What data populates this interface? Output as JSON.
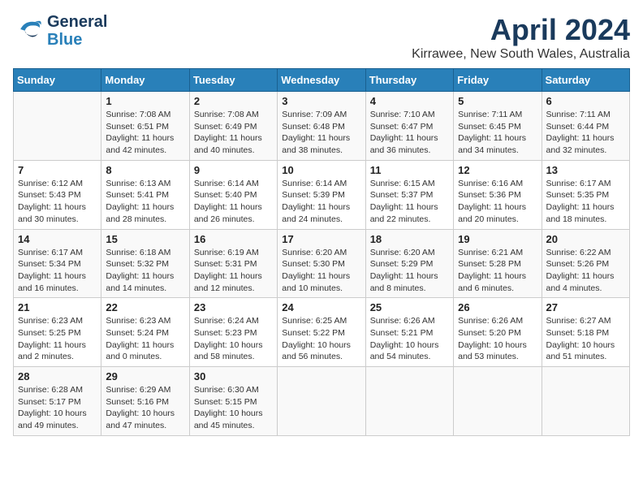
{
  "header": {
    "logo_line1": "General",
    "logo_line2": "Blue",
    "title": "April 2024",
    "subtitle": "Kirrawee, New South Wales, Australia"
  },
  "days_of_week": [
    "Sunday",
    "Monday",
    "Tuesday",
    "Wednesday",
    "Thursday",
    "Friday",
    "Saturday"
  ],
  "weeks": [
    [
      {
        "day": "",
        "sunrise": "",
        "sunset": "",
        "daylight": ""
      },
      {
        "day": "1",
        "sunrise": "Sunrise: 7:08 AM",
        "sunset": "Sunset: 6:51 PM",
        "daylight": "Daylight: 11 hours and 42 minutes."
      },
      {
        "day": "2",
        "sunrise": "Sunrise: 7:08 AM",
        "sunset": "Sunset: 6:49 PM",
        "daylight": "Daylight: 11 hours and 40 minutes."
      },
      {
        "day": "3",
        "sunrise": "Sunrise: 7:09 AM",
        "sunset": "Sunset: 6:48 PM",
        "daylight": "Daylight: 11 hours and 38 minutes."
      },
      {
        "day": "4",
        "sunrise": "Sunrise: 7:10 AM",
        "sunset": "Sunset: 6:47 PM",
        "daylight": "Daylight: 11 hours and 36 minutes."
      },
      {
        "day": "5",
        "sunrise": "Sunrise: 7:11 AM",
        "sunset": "Sunset: 6:45 PM",
        "daylight": "Daylight: 11 hours and 34 minutes."
      },
      {
        "day": "6",
        "sunrise": "Sunrise: 7:11 AM",
        "sunset": "Sunset: 6:44 PM",
        "daylight": "Daylight: 11 hours and 32 minutes."
      }
    ],
    [
      {
        "day": "7",
        "sunrise": "Sunrise: 6:12 AM",
        "sunset": "Sunset: 5:43 PM",
        "daylight": "Daylight: 11 hours and 30 minutes."
      },
      {
        "day": "8",
        "sunrise": "Sunrise: 6:13 AM",
        "sunset": "Sunset: 5:41 PM",
        "daylight": "Daylight: 11 hours and 28 minutes."
      },
      {
        "day": "9",
        "sunrise": "Sunrise: 6:14 AM",
        "sunset": "Sunset: 5:40 PM",
        "daylight": "Daylight: 11 hours and 26 minutes."
      },
      {
        "day": "10",
        "sunrise": "Sunrise: 6:14 AM",
        "sunset": "Sunset: 5:39 PM",
        "daylight": "Daylight: 11 hours and 24 minutes."
      },
      {
        "day": "11",
        "sunrise": "Sunrise: 6:15 AM",
        "sunset": "Sunset: 5:37 PM",
        "daylight": "Daylight: 11 hours and 22 minutes."
      },
      {
        "day": "12",
        "sunrise": "Sunrise: 6:16 AM",
        "sunset": "Sunset: 5:36 PM",
        "daylight": "Daylight: 11 hours and 20 minutes."
      },
      {
        "day": "13",
        "sunrise": "Sunrise: 6:17 AM",
        "sunset": "Sunset: 5:35 PM",
        "daylight": "Daylight: 11 hours and 18 minutes."
      }
    ],
    [
      {
        "day": "14",
        "sunrise": "Sunrise: 6:17 AM",
        "sunset": "Sunset: 5:34 PM",
        "daylight": "Daylight: 11 hours and 16 minutes."
      },
      {
        "day": "15",
        "sunrise": "Sunrise: 6:18 AM",
        "sunset": "Sunset: 5:32 PM",
        "daylight": "Daylight: 11 hours and 14 minutes."
      },
      {
        "day": "16",
        "sunrise": "Sunrise: 6:19 AM",
        "sunset": "Sunset: 5:31 PM",
        "daylight": "Daylight: 11 hours and 12 minutes."
      },
      {
        "day": "17",
        "sunrise": "Sunrise: 6:20 AM",
        "sunset": "Sunset: 5:30 PM",
        "daylight": "Daylight: 11 hours and 10 minutes."
      },
      {
        "day": "18",
        "sunrise": "Sunrise: 6:20 AM",
        "sunset": "Sunset: 5:29 PM",
        "daylight": "Daylight: 11 hours and 8 minutes."
      },
      {
        "day": "19",
        "sunrise": "Sunrise: 6:21 AM",
        "sunset": "Sunset: 5:28 PM",
        "daylight": "Daylight: 11 hours and 6 minutes."
      },
      {
        "day": "20",
        "sunrise": "Sunrise: 6:22 AM",
        "sunset": "Sunset: 5:26 PM",
        "daylight": "Daylight: 11 hours and 4 minutes."
      }
    ],
    [
      {
        "day": "21",
        "sunrise": "Sunrise: 6:23 AM",
        "sunset": "Sunset: 5:25 PM",
        "daylight": "Daylight: 11 hours and 2 minutes."
      },
      {
        "day": "22",
        "sunrise": "Sunrise: 6:23 AM",
        "sunset": "Sunset: 5:24 PM",
        "daylight": "Daylight: 11 hours and 0 minutes."
      },
      {
        "day": "23",
        "sunrise": "Sunrise: 6:24 AM",
        "sunset": "Sunset: 5:23 PM",
        "daylight": "Daylight: 10 hours and 58 minutes."
      },
      {
        "day": "24",
        "sunrise": "Sunrise: 6:25 AM",
        "sunset": "Sunset: 5:22 PM",
        "daylight": "Daylight: 10 hours and 56 minutes."
      },
      {
        "day": "25",
        "sunrise": "Sunrise: 6:26 AM",
        "sunset": "Sunset: 5:21 PM",
        "daylight": "Daylight: 10 hours and 54 minutes."
      },
      {
        "day": "26",
        "sunrise": "Sunrise: 6:26 AM",
        "sunset": "Sunset: 5:20 PM",
        "daylight": "Daylight: 10 hours and 53 minutes."
      },
      {
        "day": "27",
        "sunrise": "Sunrise: 6:27 AM",
        "sunset": "Sunset: 5:18 PM",
        "daylight": "Daylight: 10 hours and 51 minutes."
      }
    ],
    [
      {
        "day": "28",
        "sunrise": "Sunrise: 6:28 AM",
        "sunset": "Sunset: 5:17 PM",
        "daylight": "Daylight: 10 hours and 49 minutes."
      },
      {
        "day": "29",
        "sunrise": "Sunrise: 6:29 AM",
        "sunset": "Sunset: 5:16 PM",
        "daylight": "Daylight: 10 hours and 47 minutes."
      },
      {
        "day": "30",
        "sunrise": "Sunrise: 6:30 AM",
        "sunset": "Sunset: 5:15 PM",
        "daylight": "Daylight: 10 hours and 45 minutes."
      },
      {
        "day": "",
        "sunrise": "",
        "sunset": "",
        "daylight": ""
      },
      {
        "day": "",
        "sunrise": "",
        "sunset": "",
        "daylight": ""
      },
      {
        "day": "",
        "sunrise": "",
        "sunset": "",
        "daylight": ""
      },
      {
        "day": "",
        "sunrise": "",
        "sunset": "",
        "daylight": ""
      }
    ]
  ]
}
